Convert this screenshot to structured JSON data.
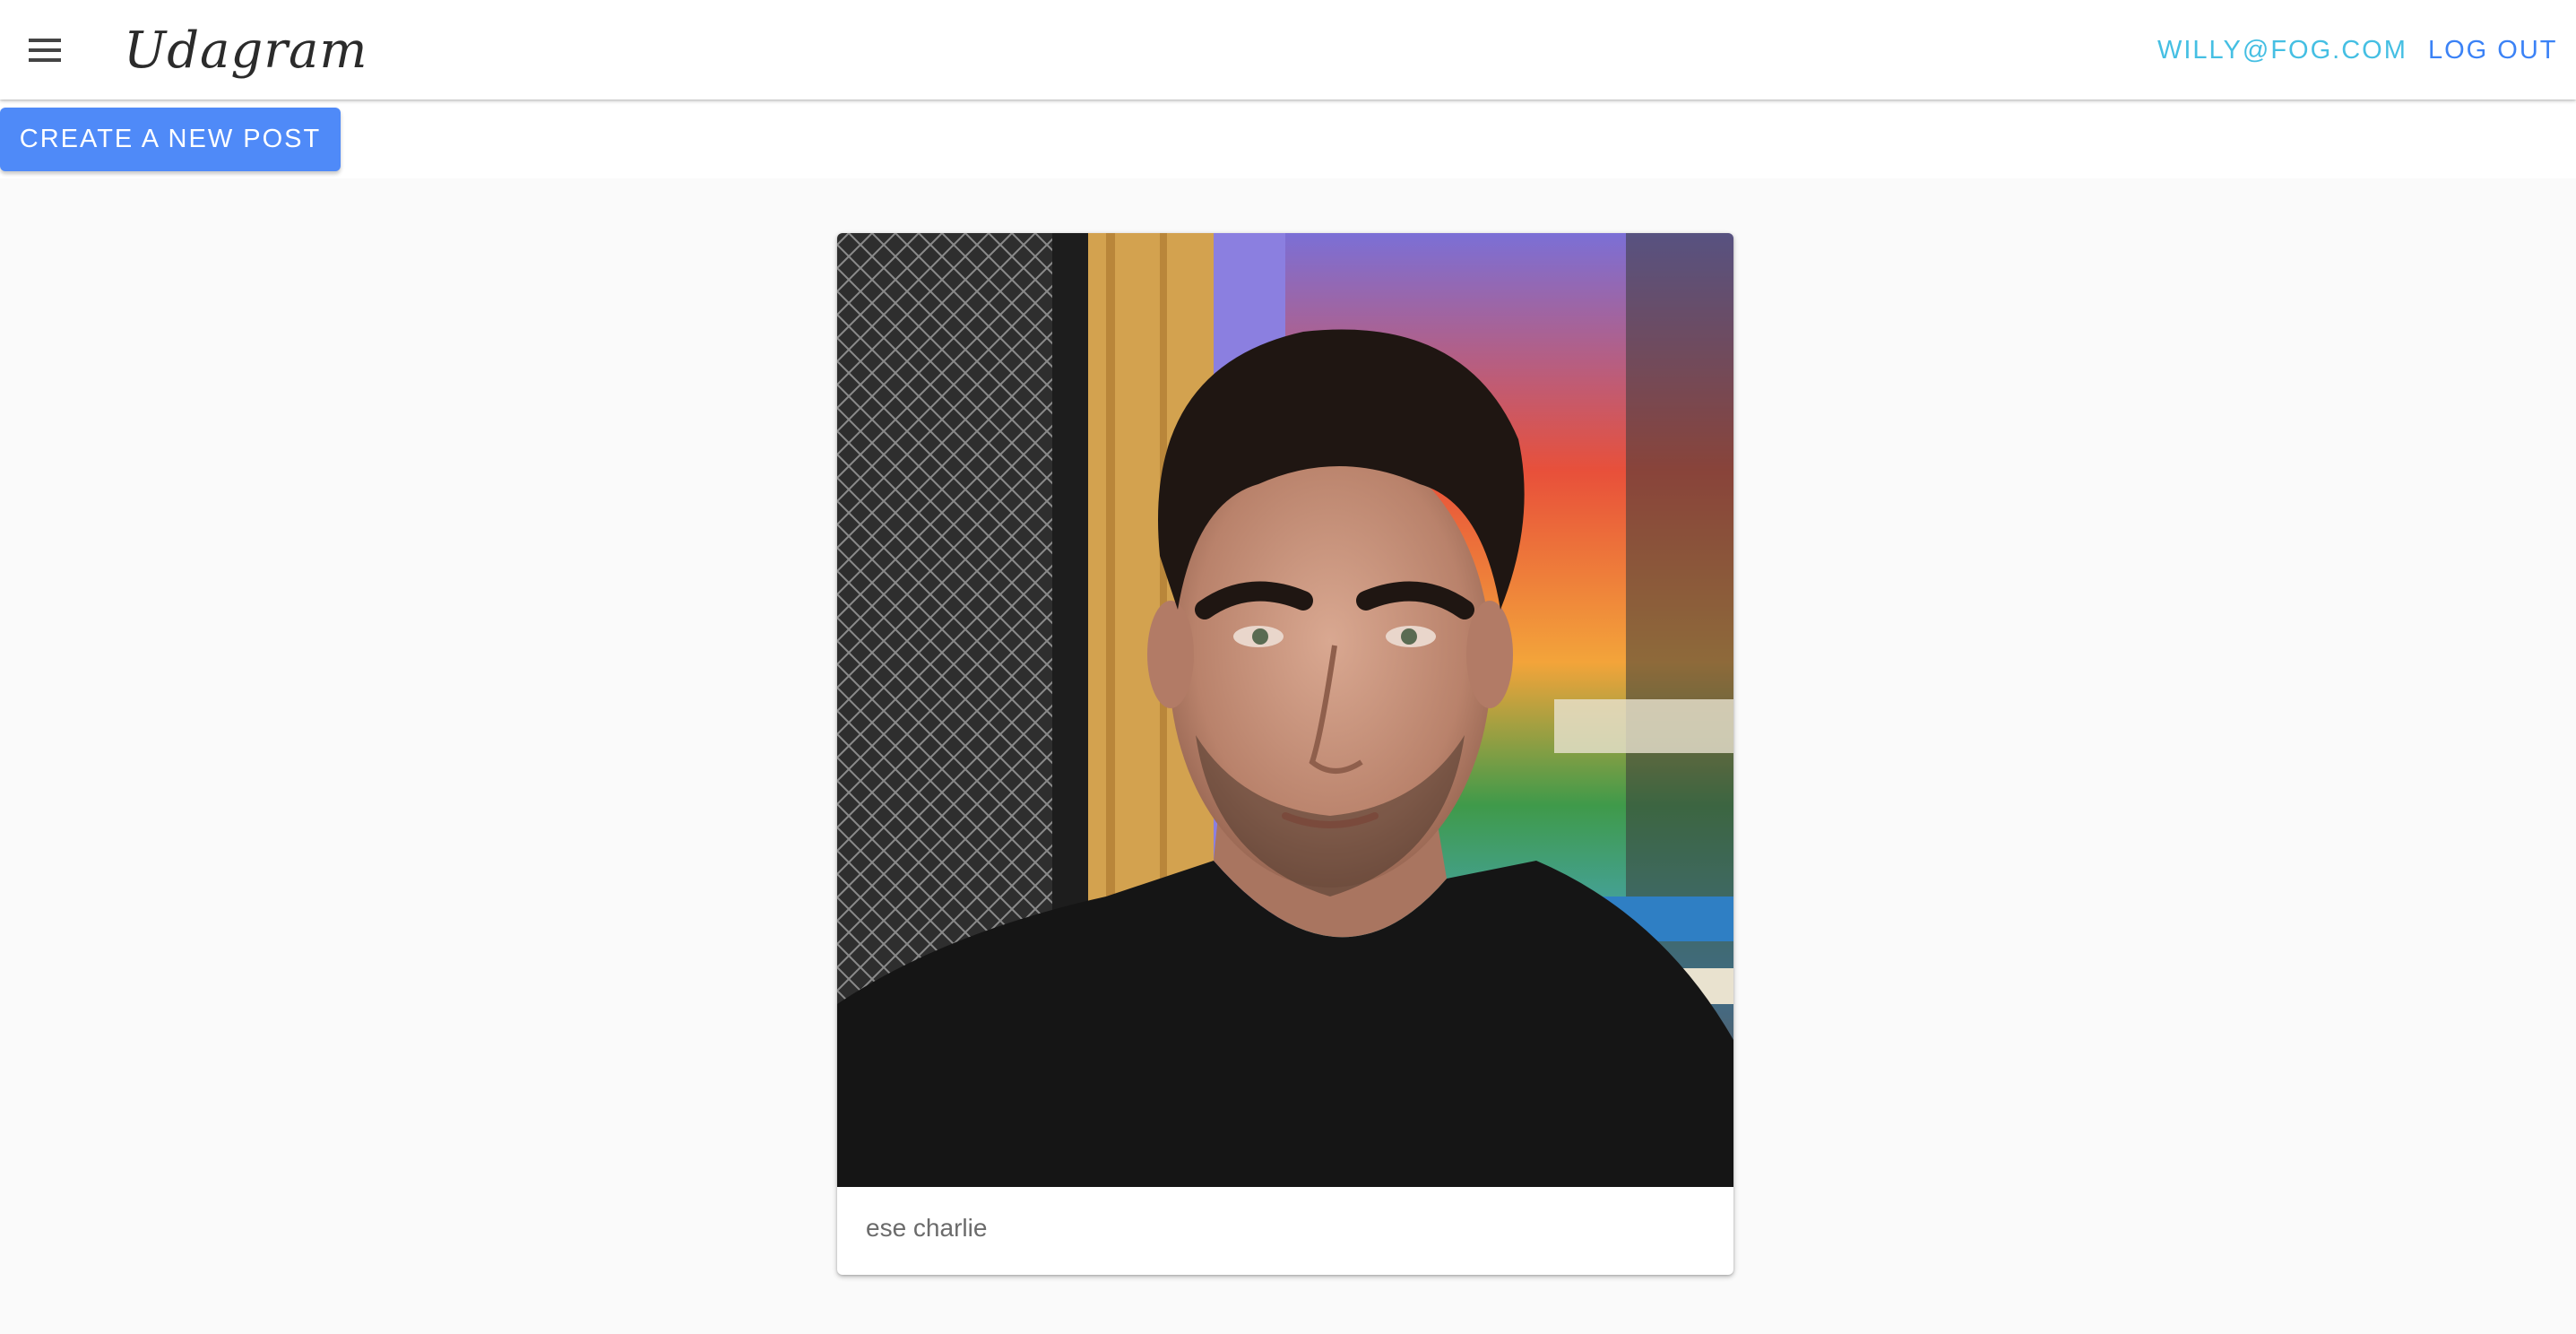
{
  "header": {
    "menu_icon": "hamburger-menu-icon",
    "brand": "Udagram",
    "user_email": "WILLY@FOG.COM",
    "logout_label": "LOG OUT",
    "colors": {
      "email": "#45bfe3",
      "logout": "#3b82f6"
    }
  },
  "actions": {
    "create_post_label": "CREATE A NEW POST",
    "button_color": "#4f8af8"
  },
  "feed": {
    "posts": [
      {
        "image_alt": "photo",
        "caption": "ese charlie"
      }
    ]
  }
}
